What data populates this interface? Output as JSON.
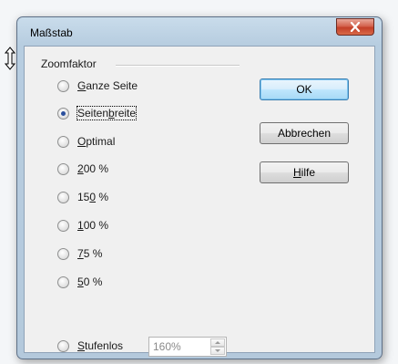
{
  "dialog": {
    "title": "Maßstab",
    "close_symbol": "X"
  },
  "zoom_group": {
    "label": "Zoomfaktor",
    "options": [
      {
        "before": "",
        "key": "G",
        "after": "anze Seite",
        "checked": false
      },
      {
        "before": "Seiten",
        "key": "b",
        "after": "reite",
        "checked": true
      },
      {
        "before": "",
        "key": "O",
        "after": "ptimal",
        "checked": false
      },
      {
        "before": "",
        "key": "2",
        "after": "00 %",
        "checked": false
      },
      {
        "before": "15",
        "key": "0",
        "after": " %",
        "checked": false
      },
      {
        "before": "",
        "key": "1",
        "after": "00 %",
        "checked": false
      },
      {
        "before": "",
        "key": "7",
        "after": "5 %",
        "checked": false
      },
      {
        "before": "",
        "key": "5",
        "after": "0 %",
        "checked": false
      },
      {
        "before": "",
        "key": "S",
        "after": "tufenlos",
        "checked": false
      }
    ],
    "custom_value": "160%"
  },
  "buttons": {
    "ok": "OK",
    "cancel": "Abbrechen",
    "help_key": "H",
    "help_rest": "ilfe"
  },
  "icons": {
    "close": "close-icon",
    "cursor": "resize-cursor-icon",
    "spin_up": "chevron-up-icon",
    "spin_down": "chevron-down-icon"
  },
  "colors": {
    "title_bar": "#c9dceb",
    "close_button": "#c33f28",
    "default_button_border": "#3c7fb1",
    "radio_dot": "#2a4f9d"
  }
}
